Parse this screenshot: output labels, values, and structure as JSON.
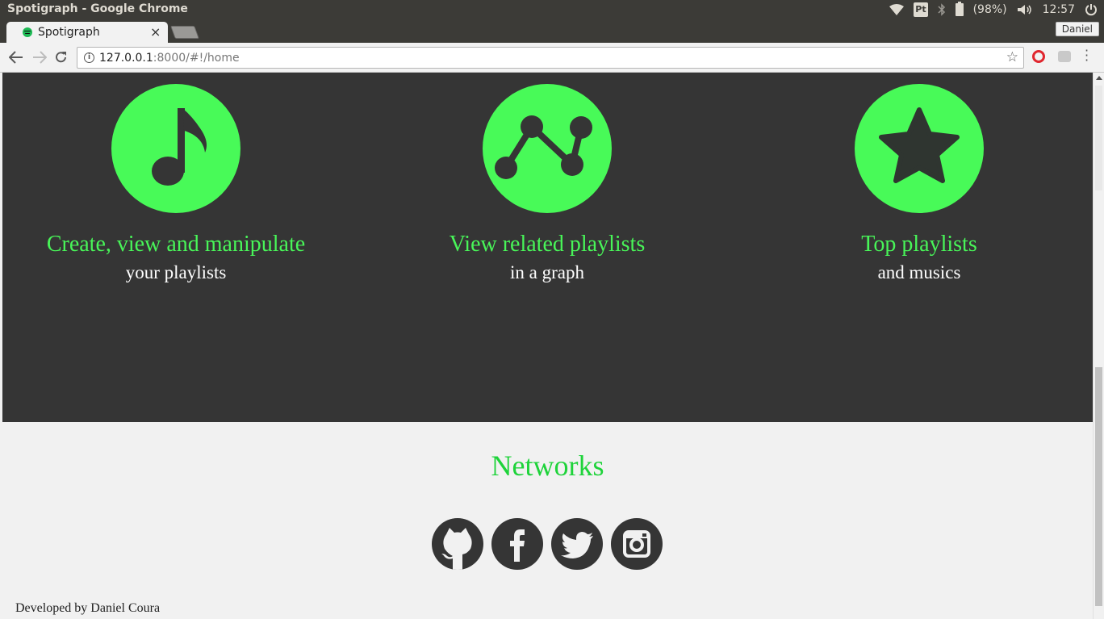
{
  "os": {
    "window_title": "Spotigraph - Google Chrome",
    "pt_label": "Pt",
    "battery_text": "(98%)",
    "clock": "12:57"
  },
  "browser": {
    "tab_title": "Spotigraph",
    "tab_close": "×",
    "profile_name": "Daniel",
    "url_host": "127.0.0.1",
    "url_rest": ":8000/#!/home"
  },
  "features": [
    {
      "icon": "music-note-icon",
      "title": "Create, view and manipulate",
      "subtitle": "your playlists"
    },
    {
      "icon": "graph-icon",
      "title": "View related playlists",
      "subtitle": "in a graph"
    },
    {
      "icon": "star-icon",
      "title": "Top playlists",
      "subtitle": "and musics"
    }
  ],
  "networks": {
    "title": "Networks",
    "items": [
      {
        "icon": "github-icon"
      },
      {
        "icon": "facebook-icon"
      },
      {
        "icon": "twitter-icon"
      },
      {
        "icon": "instagram-icon"
      }
    ]
  },
  "footer": {
    "text": "Developed by Daniel Coura"
  },
  "colors": {
    "accent_green": "#48fa58",
    "dark_bg": "#353535",
    "light_bg": "#f1f1f1",
    "networks_green": "#1ed33a"
  }
}
